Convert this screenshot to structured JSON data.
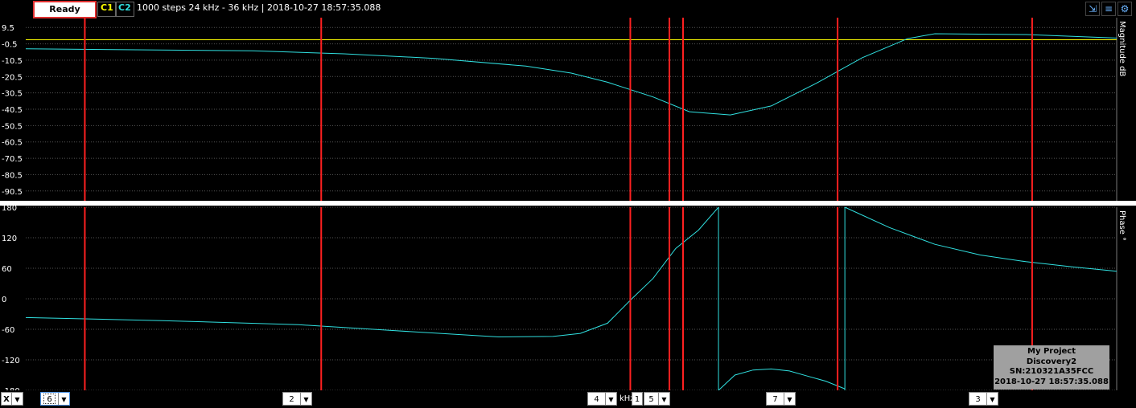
{
  "toolbar": {
    "status": "Ready",
    "channel1": "C1",
    "channel2": "C2",
    "info": "1000 steps  24 kHz - 36 kHz | 2018-10-27 18:57:35.088"
  },
  "colors": {
    "channel1": "#ffff00",
    "channel2": "#30e0e0",
    "marker": "#ff2020",
    "grid": "#555555"
  },
  "bottom": {
    "x_axis": "X",
    "markers": [
      {
        "id": "6",
        "label": "6"
      },
      {
        "id": "2",
        "label": "2"
      },
      {
        "id": "4",
        "label": "4"
      },
      {
        "id": "1",
        "label": "1"
      },
      {
        "id": "5",
        "label": "5"
      },
      {
        "id": "7",
        "label": "7"
      },
      {
        "id": "3",
        "label": "3"
      }
    ],
    "unit": "kHz"
  },
  "infobox": {
    "project": "My Project",
    "device": "Discovery2",
    "serial": "SN:210321A35FCC",
    "timestamp": "2018-10-27 18:57:35.088"
  },
  "chart_data": [
    {
      "type": "line",
      "ylabel": "Magnitude dB",
      "ylim": [
        -96.5,
        15.5
      ],
      "yticks": [
        "9.5",
        "-0.5",
        "-10.5",
        "-20.5",
        "-30.5",
        "-40.5",
        "-50.5",
        "-60.5",
        "-70.5",
        "-80.5",
        "-90.5"
      ],
      "ytick_values": [
        9.5,
        -0.5,
        -10.5,
        -20.5,
        -30.5,
        -40.5,
        -50.5,
        -60.5,
        -70.5,
        -80.5,
        -90.5
      ],
      "xlim": [
        24,
        36
      ],
      "grid": true,
      "series": [
        {
          "channel": "C1",
          "x": [
            24,
            36
          ],
          "y": [
            2,
            2
          ]
        },
        {
          "channel": "C2",
          "x": [
            24,
            26.5,
            27.5,
            28.5,
            29.5,
            30,
            30.4,
            30.9,
            31.3,
            31.75,
            32.2,
            32.7,
            33.2,
            33.7,
            34,
            35,
            36
          ],
          "y": [
            -3.5,
            -4.8,
            -6.6,
            -9.4,
            -14.1,
            -18.4,
            -24,
            -33,
            -42,
            -44,
            -38.5,
            -24.5,
            -9,
            2.7,
            5.7,
            5.2,
            3
          ]
        }
      ],
      "markers_x": [
        24.65,
        27.25,
        30.65,
        31.08,
        31.23,
        32.93,
        35.07
      ]
    },
    {
      "type": "line",
      "ylabel": "Phase °",
      "ylim": [
        -180,
        180
      ],
      "yticks": [
        "180",
        "120",
        "60",
        "0",
        "-60",
        "-120",
        "-180"
      ],
      "ytick_values": [
        180,
        120,
        60,
        0,
        -60,
        -120,
        -180
      ],
      "xlim": [
        24,
        36
      ],
      "grid": true,
      "series": [
        {
          "channel": "C2",
          "segments": [
            {
              "x": [
                24,
                25.5,
                27,
                28,
                29.2,
                29.8,
                30.1,
                30.4,
                30.65,
                30.9,
                31.15,
                31.4,
                31.62
              ],
              "y": [
                -37,
                -43,
                -51,
                -62,
                -75,
                -74,
                -68,
                -48,
                -3,
                40,
                99,
                135,
                180
              ]
            },
            {
              "x": [
                31.62,
                31.8,
                32,
                32.2,
                32.4,
                32.6,
                32.8,
                33.01
              ],
              "y": [
                -180,
                -150,
                -140,
                -138,
                -142,
                -152,
                -162,
                -177
              ]
            },
            {
              "x": [
                33.01,
                33.5,
                34,
                34.5,
                35,
                35.5,
                36
              ],
              "y": [
                180,
                140,
                107,
                86,
                73,
                63,
                54
              ]
            }
          ]
        }
      ],
      "markers_x": [
        24.65,
        27.25,
        30.65,
        31.08,
        31.23,
        32.93,
        35.07
      ]
    }
  ]
}
